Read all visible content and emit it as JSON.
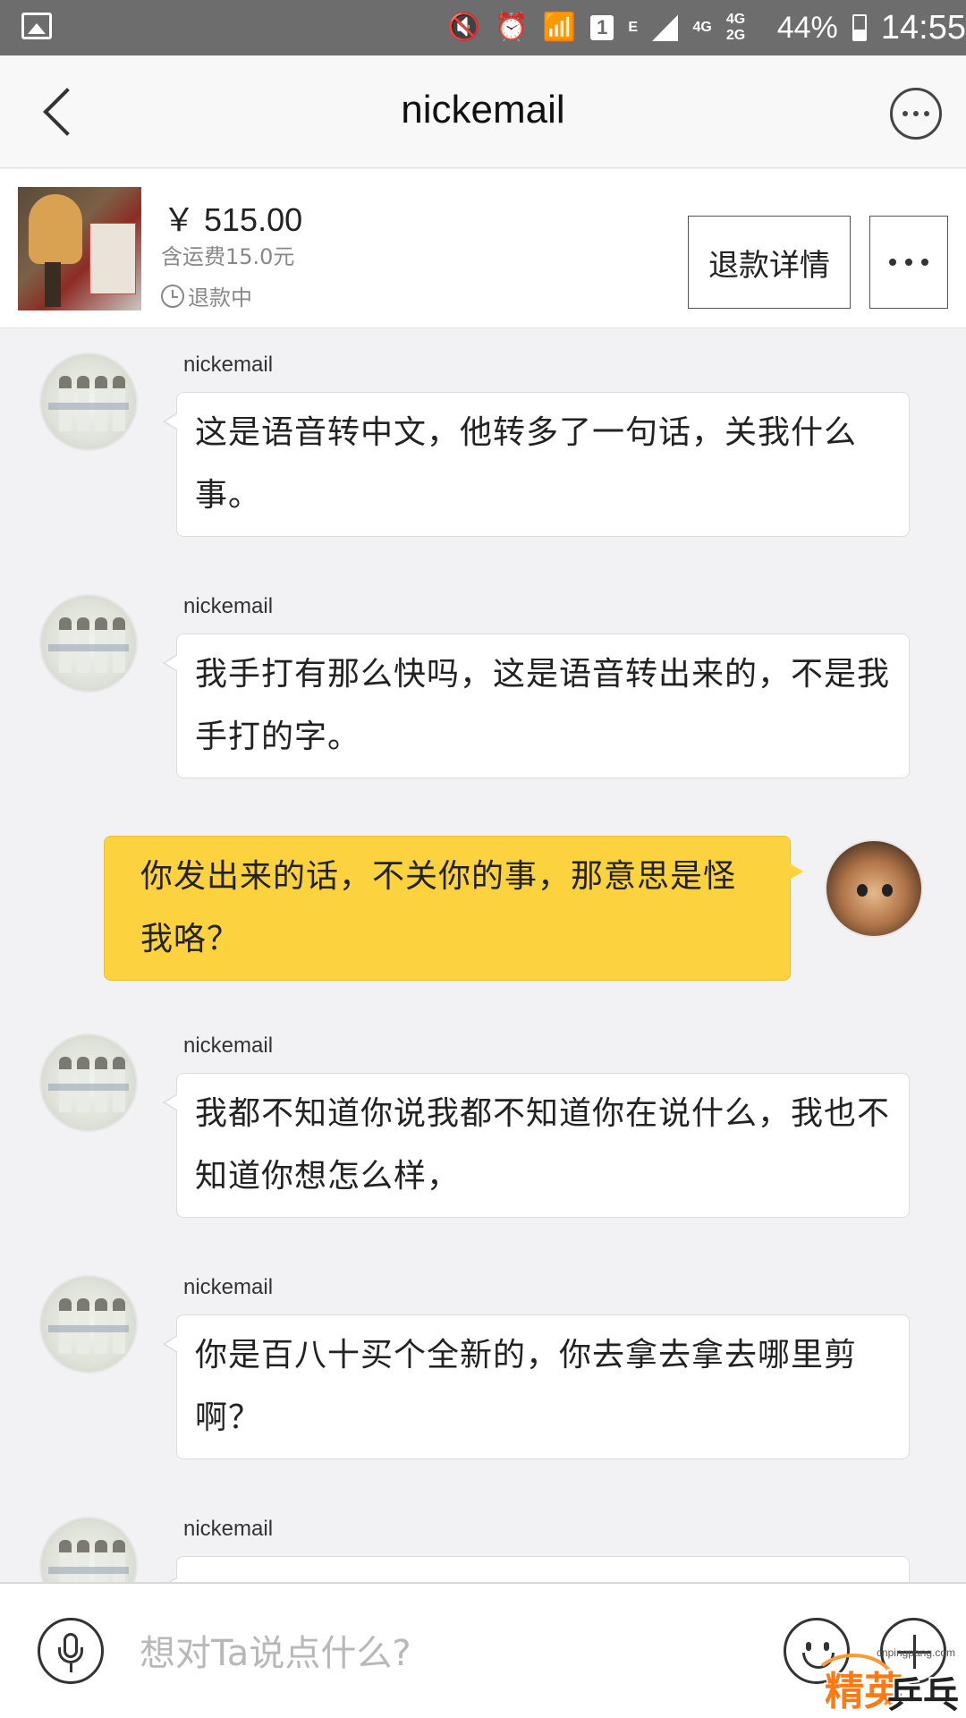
{
  "status_bar": {
    "sim_badge": "1",
    "net_e": "E",
    "net_4g": "4G",
    "net_4g2g": "4G 2G",
    "battery": "44%",
    "time": "14:55"
  },
  "header": {
    "title": "nickemail"
  },
  "product": {
    "price": "￥ 515.00",
    "shipping": "含运费15.0元",
    "status": "退款中",
    "refund_button": "退款详情"
  },
  "messages": [
    {
      "side": "left",
      "sender": "nickemail",
      "text": "这是语音转中文，他转多了一句话，关我什么事。"
    },
    {
      "side": "left",
      "sender": "nickemail",
      "text": "我手打有那么快吗，这是语音转出来的，不是我手打的字。"
    },
    {
      "side": "right",
      "text": "你发出来的话，不关你的事，那意思是怪我咯？"
    },
    {
      "side": "left",
      "sender": "nickemail",
      "text": "我都不知道你说我都不知道你在说什么，我也不知道你想怎么样，"
    },
    {
      "side": "left",
      "sender": "nickemail",
      "text": "你是百八十买个全新的，你去拿去拿去哪里剪啊？"
    },
    {
      "side": "left",
      "sender": "nickemail",
      "text": ""
    }
  ],
  "input": {
    "placeholder": "想对Ta说点什么?"
  },
  "watermark": {
    "url": "cnpingpang.com",
    "brand_a": "精英",
    "brand_b": "乒乓网"
  }
}
